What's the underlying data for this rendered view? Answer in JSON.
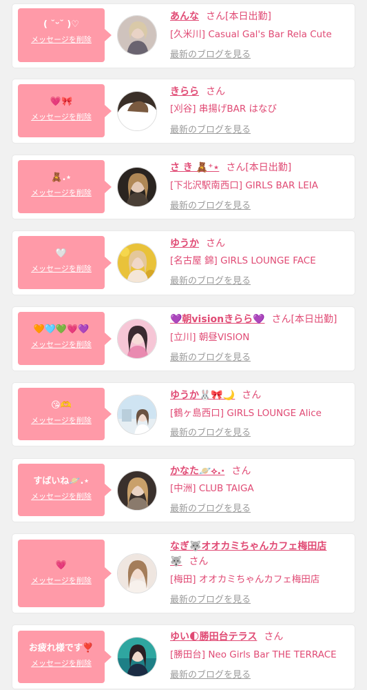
{
  "common": {
    "delete_label": "メッセージを削除",
    "blog_label": "最新のブログを見る",
    "honorific": "さん"
  },
  "colors": {
    "bubble": "#ff9aa8",
    "accent": "#e04a74",
    "muted": "#9a9a9a",
    "background": "#f1f1f1"
  },
  "entries": [
    {
      "message": "( ˘ᵕ˘ )♡",
      "name": "あんな",
      "status": "[本日出勤]",
      "name_line2": "",
      "shop": "[久米川] Casual Gal's Bar Rela Cute"
    },
    {
      "message": "💗🎀",
      "name": "きらら",
      "status": "",
      "name_line2": "",
      "shop": "[刈谷] 串揚げBAR はなび"
    },
    {
      "message": "🧸.⋆",
      "name": "さ き 🧸⁺⋆",
      "status": "[本日出勤]",
      "name_line2": "",
      "shop": "[下北沢駅南西口] GIRLS BAR LEIA"
    },
    {
      "message": "🤍",
      "name": "ゆうか",
      "status": "",
      "name_line2": "",
      "shop": "[名古屋 錦] GIRLS LOUNGE FACE"
    },
    {
      "message": "🧡🩵💚💗💜",
      "name": "💜朝visionきらら💜",
      "status": "[本日出勤]",
      "name_line2": "",
      "shop": "[立川] 朝昼VISION"
    },
    {
      "message": "😘🫶",
      "name": "ゆうか🐰🎀🌙",
      "status": "",
      "name_line2": "",
      "shop": "[鶴ヶ島西口] GIRLS LOUNGE Alice"
    },
    {
      "message": "すばいね🪐.⋆",
      "name": "かなた🪐⟡.·",
      "status": "",
      "name_line2": "",
      "shop": "[中洲] CLUB TAIGA"
    },
    {
      "message": "💗",
      "name": "なぎ🐺オオカミちゃんカフェ梅田店",
      "status": "",
      "name_line2": "🐺",
      "shop": "[梅田] オオカミちゃんカフェ梅田店"
    },
    {
      "message": "お疲れ様です❣️",
      "name": "ゆい🌓勝田台テラス",
      "status": "",
      "name_line2": "",
      "shop": "[勝田台] Neo Girls Bar THE TERRACE"
    }
  ]
}
